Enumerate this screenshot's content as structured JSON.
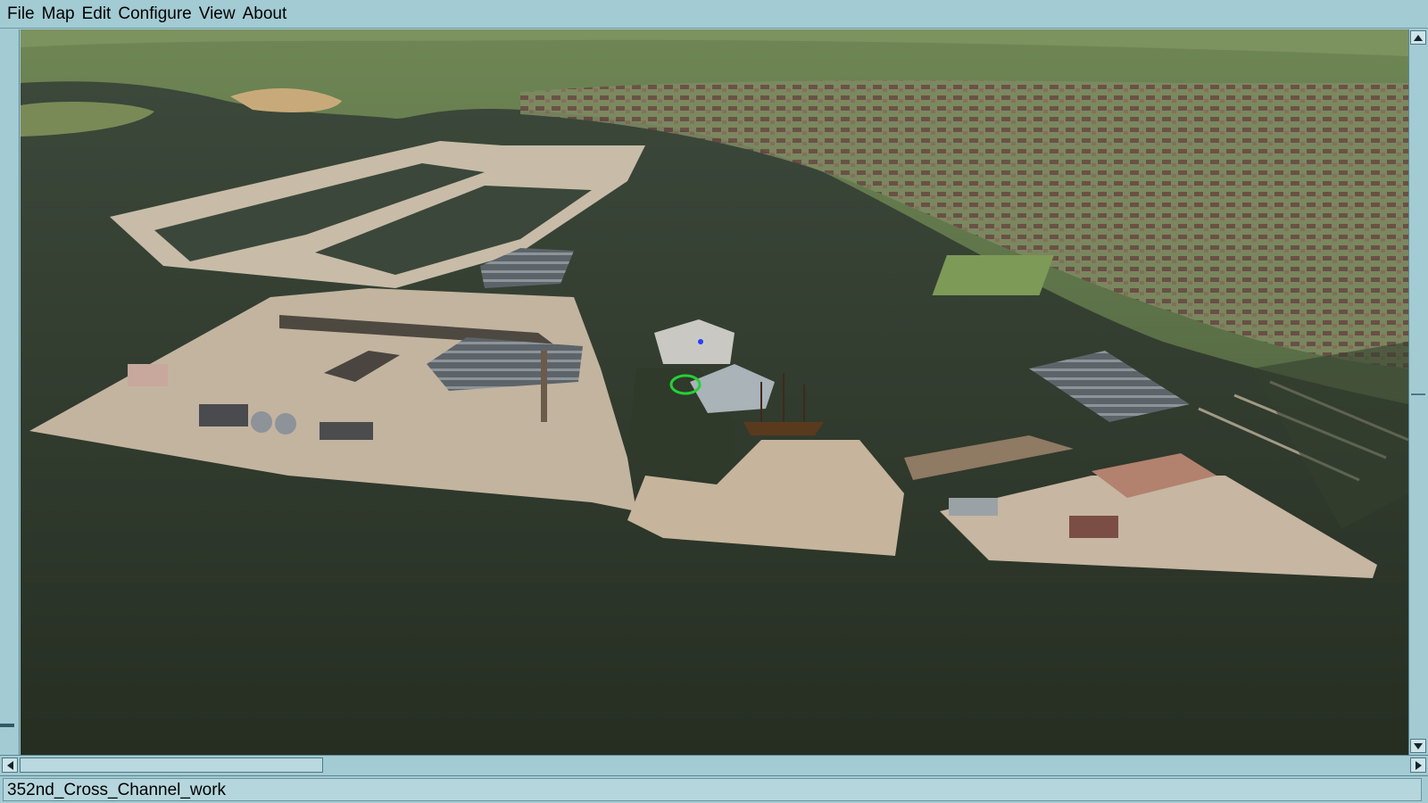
{
  "menu": {
    "items": [
      "File",
      "Map",
      "Edit",
      "Configure",
      "View",
      "About"
    ]
  },
  "status": {
    "text": "352nd_Cross_Channel_work"
  },
  "viewport": {
    "scene": "3d-harbor-map",
    "colors": {
      "water": "#2f3a2a",
      "land": "#6d7e50",
      "quay": "#c9bba5",
      "roof": "#6e7378"
    }
  },
  "icons": {
    "scroll_up": "arrow-up-icon",
    "scroll_down": "arrow-down-icon",
    "scroll_left": "arrow-left-icon",
    "scroll_right": "arrow-right-icon"
  }
}
